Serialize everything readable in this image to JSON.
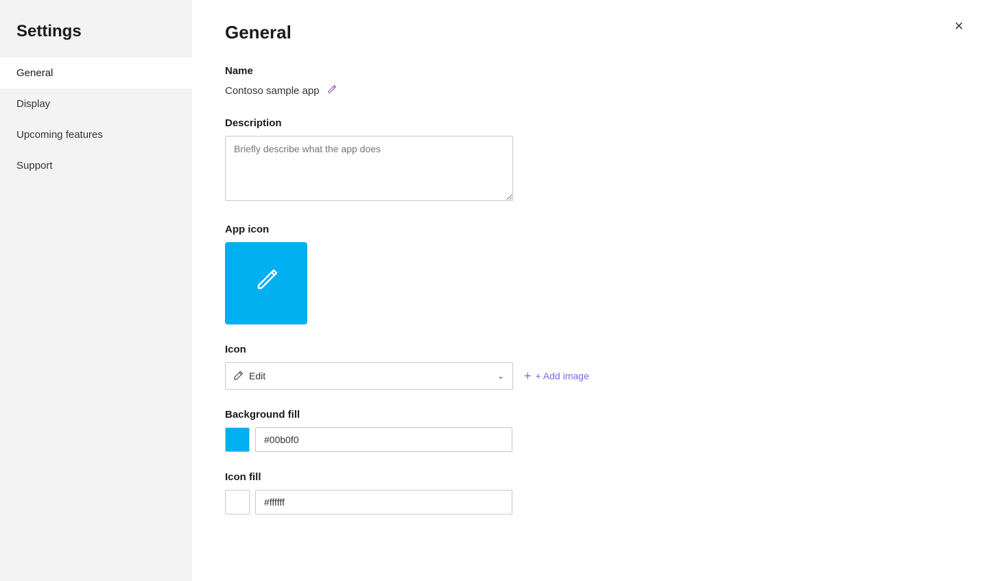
{
  "sidebar": {
    "title": "Settings",
    "items": [
      {
        "id": "general",
        "label": "General",
        "active": true
      },
      {
        "id": "display",
        "label": "Display",
        "active": false
      },
      {
        "id": "upcoming-features",
        "label": "Upcoming features",
        "active": false
      },
      {
        "id": "support",
        "label": "Support",
        "active": false
      }
    ]
  },
  "main": {
    "title": "General",
    "close_label": "×",
    "sections": {
      "name": {
        "label": "Name",
        "value": "Contoso sample app",
        "edit_icon": "✏"
      },
      "description": {
        "label": "Description",
        "placeholder": "Briefly describe what the app does"
      },
      "app_icon": {
        "label": "App icon",
        "background_color": "#00b0f0"
      },
      "icon": {
        "label": "Icon",
        "dropdown_value": "Edit",
        "dropdown_icon": "✏",
        "add_image_label": "+ Add image",
        "add_plus": "+"
      },
      "background_fill": {
        "label": "Background fill",
        "color": "#00b0f0",
        "hex_value": "#00b0f0"
      },
      "icon_fill": {
        "label": "Icon fill",
        "color": "#ffffff",
        "hex_value": "#ffffff"
      }
    }
  }
}
